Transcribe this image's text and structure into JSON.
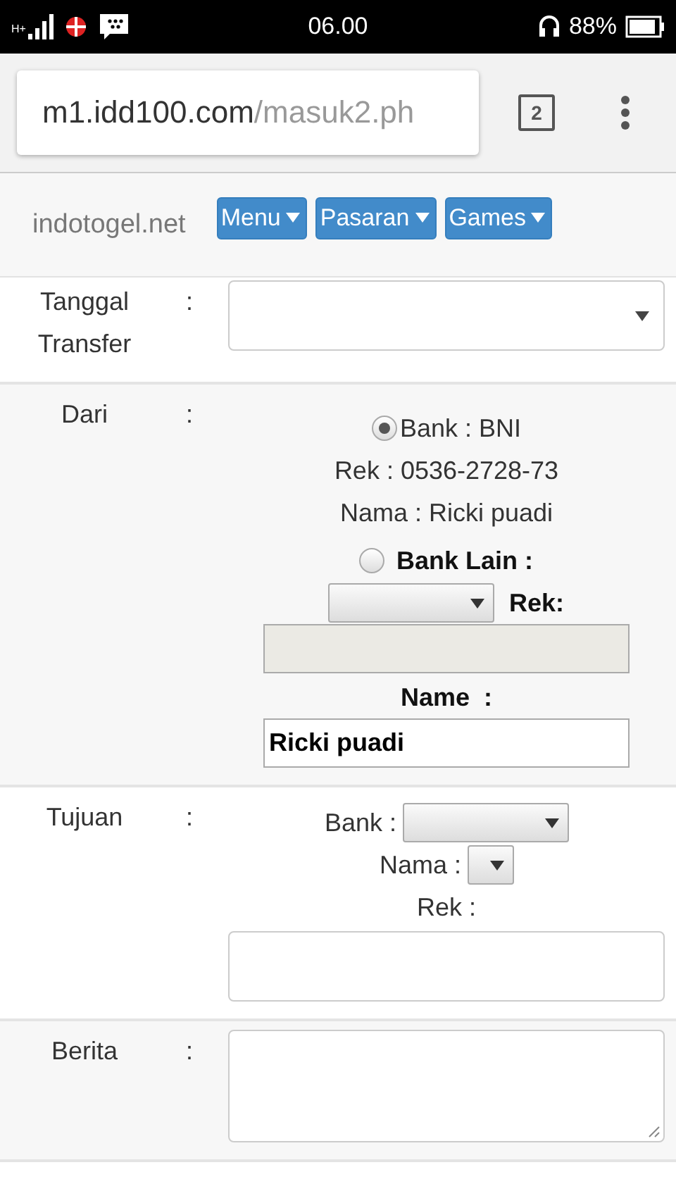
{
  "status_bar": {
    "network": "H+",
    "time": "06.00",
    "battery": "88%"
  },
  "browser": {
    "url_host": "m1.idd100.com",
    "url_path": "/masuk2.ph",
    "tab_count": "2"
  },
  "nav": {
    "site": "indotogel.net",
    "menus": [
      "Menu",
      "Pasaran",
      "Games"
    ]
  },
  "form": {
    "rows": [
      {
        "kind": "select",
        "label": "Tanggal Transfer",
        "separator": ":"
      },
      {
        "kind": "source",
        "label": "Dari",
        "separator": ":",
        "options": [
          {
            "label": "Bank : BNI",
            "selected": true,
            "lines": [
              "Rek : 0536-2728-73",
              "Nama : Ricki puadi"
            ]
          },
          {
            "label": "Bank Lain :",
            "selected": false
          }
        ],
        "rek_label": "Rek:",
        "name_label": "Name  :",
        "name_value": "Ricki puadi"
      },
      {
        "kind": "target",
        "label": "Tujuan",
        "separator": ":",
        "bank_label": "Bank :",
        "nama_label": "Nama :",
        "rek_label": "Rek :"
      },
      {
        "kind": "textarea",
        "label": "Berita",
        "separator": ":"
      }
    ]
  }
}
